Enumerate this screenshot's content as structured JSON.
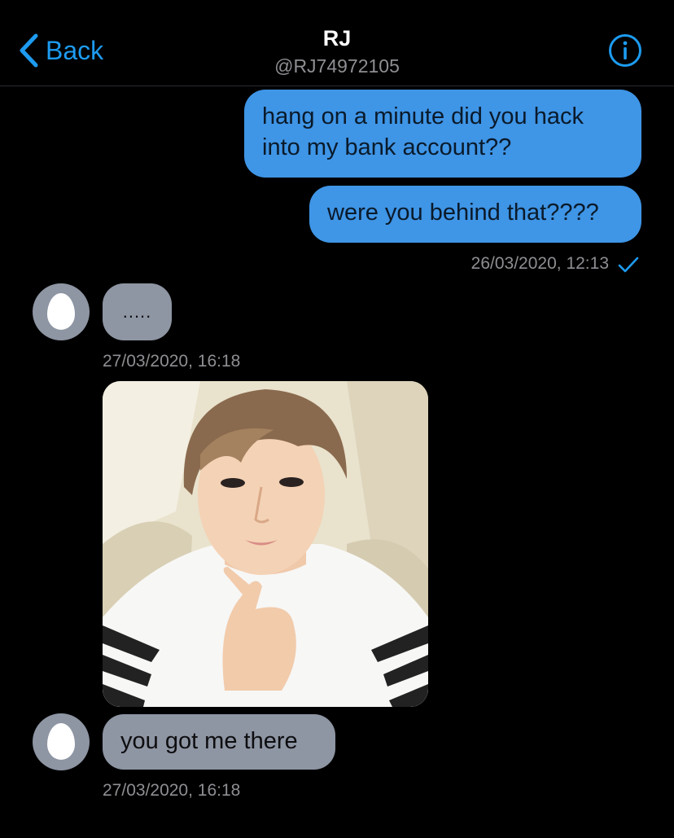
{
  "colors": {
    "accent": "#1d9bf0",
    "sent_bubble": "#3f95e6",
    "received_bubble": "#8e95a3",
    "background": "#000000"
  },
  "header": {
    "back_label": "Back",
    "name": "RJ",
    "handle": "@RJ74972105",
    "back_icon": "chevron-left-icon",
    "info_icon": "info-icon"
  },
  "messages": {
    "sent_1": "hang on a minute did you hack into my bank account??",
    "sent_2": "were you behind that????",
    "sent_timestamp": "26/03/2020, 12:13",
    "sent_status_icon": "checkmark-icon",
    "recv_1": ".....",
    "recv_1_timestamp": "27/03/2020, 16:18",
    "recv_photo": "selfie-photo",
    "recv_2": "you got me there",
    "recv_2_timestamp": "27/03/2020, 16:18",
    "avatar_icon": "default-egg-avatar"
  }
}
